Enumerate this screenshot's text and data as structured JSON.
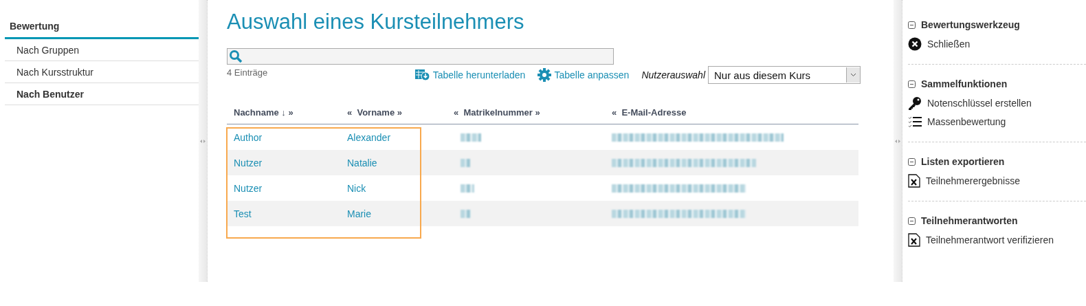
{
  "sidebar": {
    "title": "Bewertung",
    "items": [
      {
        "label": "Nach Gruppen",
        "selected": false
      },
      {
        "label": "Nach Kursstruktur",
        "selected": false
      },
      {
        "label": "Nach Benutzer",
        "selected": true
      }
    ]
  },
  "main": {
    "title": "Auswahl eines Kursteilnehmers",
    "count": "4 Einträge",
    "actions": [
      "Tabelle herunterladen",
      "Tabelle anpassen"
    ],
    "user_filter": {
      "label": "Nutzerauswahl",
      "value": "Nur aus diesem Kurs"
    },
    "table": {
      "columns": [
        "Nachname ↓ »",
        "«  Vorname »",
        "«  Matrikelnummer »",
        "«  E-Mail-Adresse"
      ],
      "rows": [
        {
          "nachname": "Author",
          "vorname": "Alexander"
        },
        {
          "nachname": "Nutzer",
          "vorname": "Natalie"
        },
        {
          "nachname": "Nutzer",
          "vorname": "Nick"
        },
        {
          "nachname": "Test",
          "vorname": "Marie"
        }
      ]
    }
  },
  "tools": [
    {
      "title": "Bewertungswerkzeug",
      "expanded": true,
      "items": [
        "Schließen"
      ]
    },
    {
      "title": "Sammelfunktionen",
      "expanded": true,
      "items": [
        "Notenschlüssel erstellen",
        "Massenbewertung"
      ]
    },
    {
      "title": "Listen exportieren",
      "expanded": true,
      "items": [
        "Teilnehmerergebnisse"
      ]
    },
    {
      "title": "Teilnehmerantworten",
      "expanded": true,
      "items": [
        "Teilnehmerantwort verifizieren"
      ]
    }
  ]
}
